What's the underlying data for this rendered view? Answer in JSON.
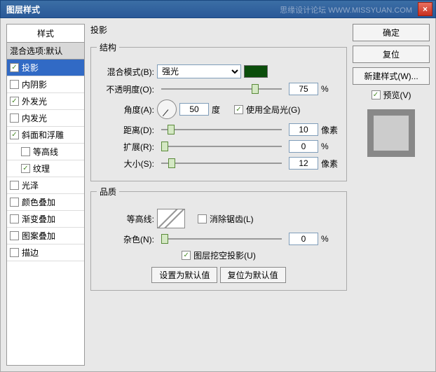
{
  "window": {
    "title": "图层样式",
    "watermark": "思缘设计论坛 WWW.MISSYUAN.COM"
  },
  "buttons": {
    "ok": "确定",
    "cancel": "复位",
    "newStyle": "新建样式(W)...",
    "preview": "预览(V)",
    "close": "×"
  },
  "sidebar": {
    "header": "样式",
    "blend": "混合选项:默认",
    "items": [
      {
        "label": "投影",
        "checked": true,
        "active": true
      },
      {
        "label": "内阴影",
        "checked": false
      },
      {
        "label": "外发光",
        "checked": true
      },
      {
        "label": "内发光",
        "checked": false
      },
      {
        "label": "斜面和浮雕",
        "checked": true
      },
      {
        "label": "等高线",
        "checked": false,
        "sub": true
      },
      {
        "label": "纹理",
        "checked": true,
        "sub": true
      },
      {
        "label": "光泽",
        "checked": false
      },
      {
        "label": "颜色叠加",
        "checked": false
      },
      {
        "label": "渐变叠加",
        "checked": false
      },
      {
        "label": "图案叠加",
        "checked": false
      },
      {
        "label": "描边",
        "checked": false
      }
    ]
  },
  "main": {
    "title": "投影",
    "structure": {
      "legend": "结构",
      "blendMode": {
        "label": "混合模式(B):",
        "value": "强光"
      },
      "opacity": {
        "label": "不透明度(O):",
        "value": "75",
        "unit": "%"
      },
      "angle": {
        "label": "角度(A):",
        "value": "50",
        "unit": "度",
        "globalLight": "使用全局光(G)",
        "globalChecked": true
      },
      "distance": {
        "label": "距离(D):",
        "value": "10",
        "unit": "像素"
      },
      "spread": {
        "label": "扩展(R):",
        "value": "0",
        "unit": "%"
      },
      "size": {
        "label": "大小(S):",
        "value": "12",
        "unit": "像素"
      }
    },
    "quality": {
      "legend": "品质",
      "contour": {
        "label": "等高线:",
        "antialias": "消除锯齿(L)",
        "antialiasChecked": false
      },
      "noise": {
        "label": "杂色(N):",
        "value": "0",
        "unit": "%"
      },
      "knockout": {
        "label": "图层挖空投影(U)",
        "checked": true
      }
    },
    "footerButtons": {
      "default": "设置为默认值",
      "reset": "复位为默认值"
    }
  }
}
